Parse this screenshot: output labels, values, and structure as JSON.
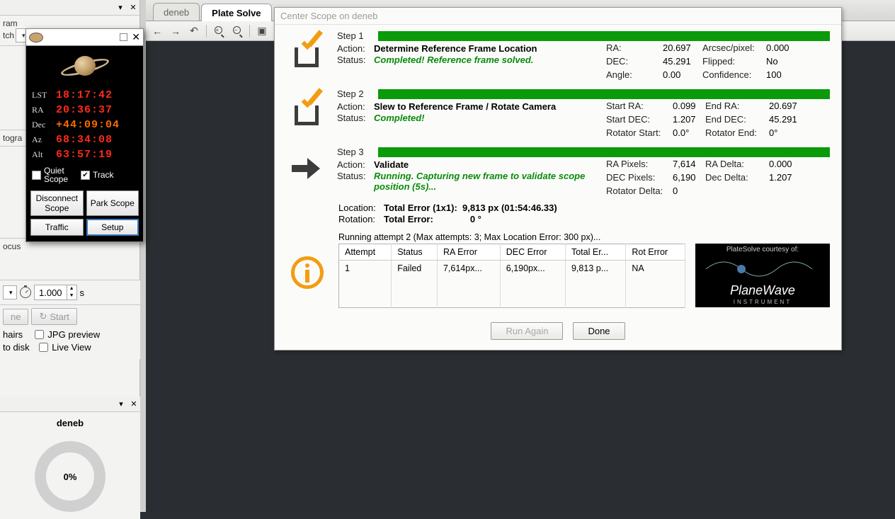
{
  "left": {
    "top_panel_label1": "ram",
    "top_panel_label2": "tch",
    "middle_label": "togra",
    "focus_label": "ocus",
    "jpg_preview": "JPG preview",
    "live_view": "Live View",
    "to_disk": "to disk",
    "hairs": "hairs",
    "ne": "ne",
    "start": "Start",
    "exp_value": "1.000",
    "exp_unit": "s",
    "deneb_title": "deneb",
    "progress": "0%"
  },
  "scope": {
    "close": "✕",
    "lst_label": "LST",
    "lst": "18:17:42",
    "ra_label": "RA",
    "ra": "20:36:37",
    "dec_label": "Dec",
    "dec": "+44:09:04",
    "az_label": "Az",
    "az": "68:34:08",
    "alt_label": "Alt",
    "alt": "63:57:19",
    "quiet": "Quiet Scope",
    "track": "Track",
    "disconnect": "Disconnect Scope",
    "park": "Park Scope",
    "traffic": "Traffic",
    "setup": "Setup"
  },
  "tabs": {
    "deneb": "deneb",
    "plate": "Plate Solve"
  },
  "dlg": {
    "title": "Center Scope on deneb",
    "step1": {
      "label": "Step 1",
      "action_k": "Action:",
      "action_v": "Determine Reference Frame Location",
      "status_k": "Status:",
      "status_v": "Completed!  Reference frame solved.",
      "ra_k": "RA:",
      "ra_v": "20.697",
      "dec_k": "DEC:",
      "dec_v": "45.291",
      "angle_k": "Angle:",
      "angle_v": "0.00",
      "arc_k": "Arcsec/pixel:",
      "arc_v": "0.000",
      "flip_k": "Flipped:",
      "flip_v": "No",
      "conf_k": "Confidence:",
      "conf_v": "100"
    },
    "step2": {
      "label": "Step 2",
      "action_k": "Action:",
      "action_v": "Slew to Reference Frame / Rotate Camera",
      "status_k": "Status:",
      "status_v": "Completed!",
      "sra_k": "Start RA:",
      "sra_v": "0.099",
      "sdec_k": "Start DEC:",
      "sdec_v": "1.207",
      "rstart_k": "Rotator Start:",
      "rstart_v": "0.0°",
      "era_k": "End RA:",
      "era_v": "20.697",
      "edec_k": "End DEC:",
      "edec_v": "45.291",
      "rend_k": "Rotator End:",
      "rend_v": "0°"
    },
    "step3": {
      "label": "Step 3",
      "action_k": "Action:",
      "action_v": "Validate",
      "status_k": "Status:",
      "status_v": "Running.  Capturing new frame to validate scope position (5s)...",
      "rapx_k": "RA Pixels:",
      "rapx_v": "7,614",
      "decpx_k": "DEC Pixels:",
      "decpx_v": "6,190",
      "rotd_k": "Rotator Delta:",
      "rotd_v": "0",
      "rad_k": "RA Delta:",
      "rad_v": "0.000",
      "decd_k": "Dec Delta:",
      "decd_v": "1.207"
    },
    "summary": {
      "loc_k": "Location:",
      "loc_v": "Total Error (1x1):",
      "loc_num": "9,813 px (01:54:46.33)",
      "rot_k": "Rotation:",
      "rot_v": "Total Error:",
      "rot_num": "0 °"
    },
    "attempts_label": "Running attempt 2 (Max attempts: 3; Max Location Error: 300 px)...",
    "table": {
      "h1": "Attempt",
      "h2": "Status",
      "h3": "RA Error",
      "h4": "DEC Error",
      "h5": "Total Er...",
      "h6": "Rot Error",
      "r1c1": "1",
      "r1c2": "Failed",
      "r1c3": "7,614px...",
      "r1c4": "6,190px...",
      "r1c5": "9,813 p...",
      "r1c6": "NA"
    },
    "planewave": {
      "top": "PlateSolve courtesy of:",
      "name": "PlaneWave",
      "sub": "INSTRUMENT"
    },
    "run_again": "Run Again",
    "done": "Done"
  }
}
